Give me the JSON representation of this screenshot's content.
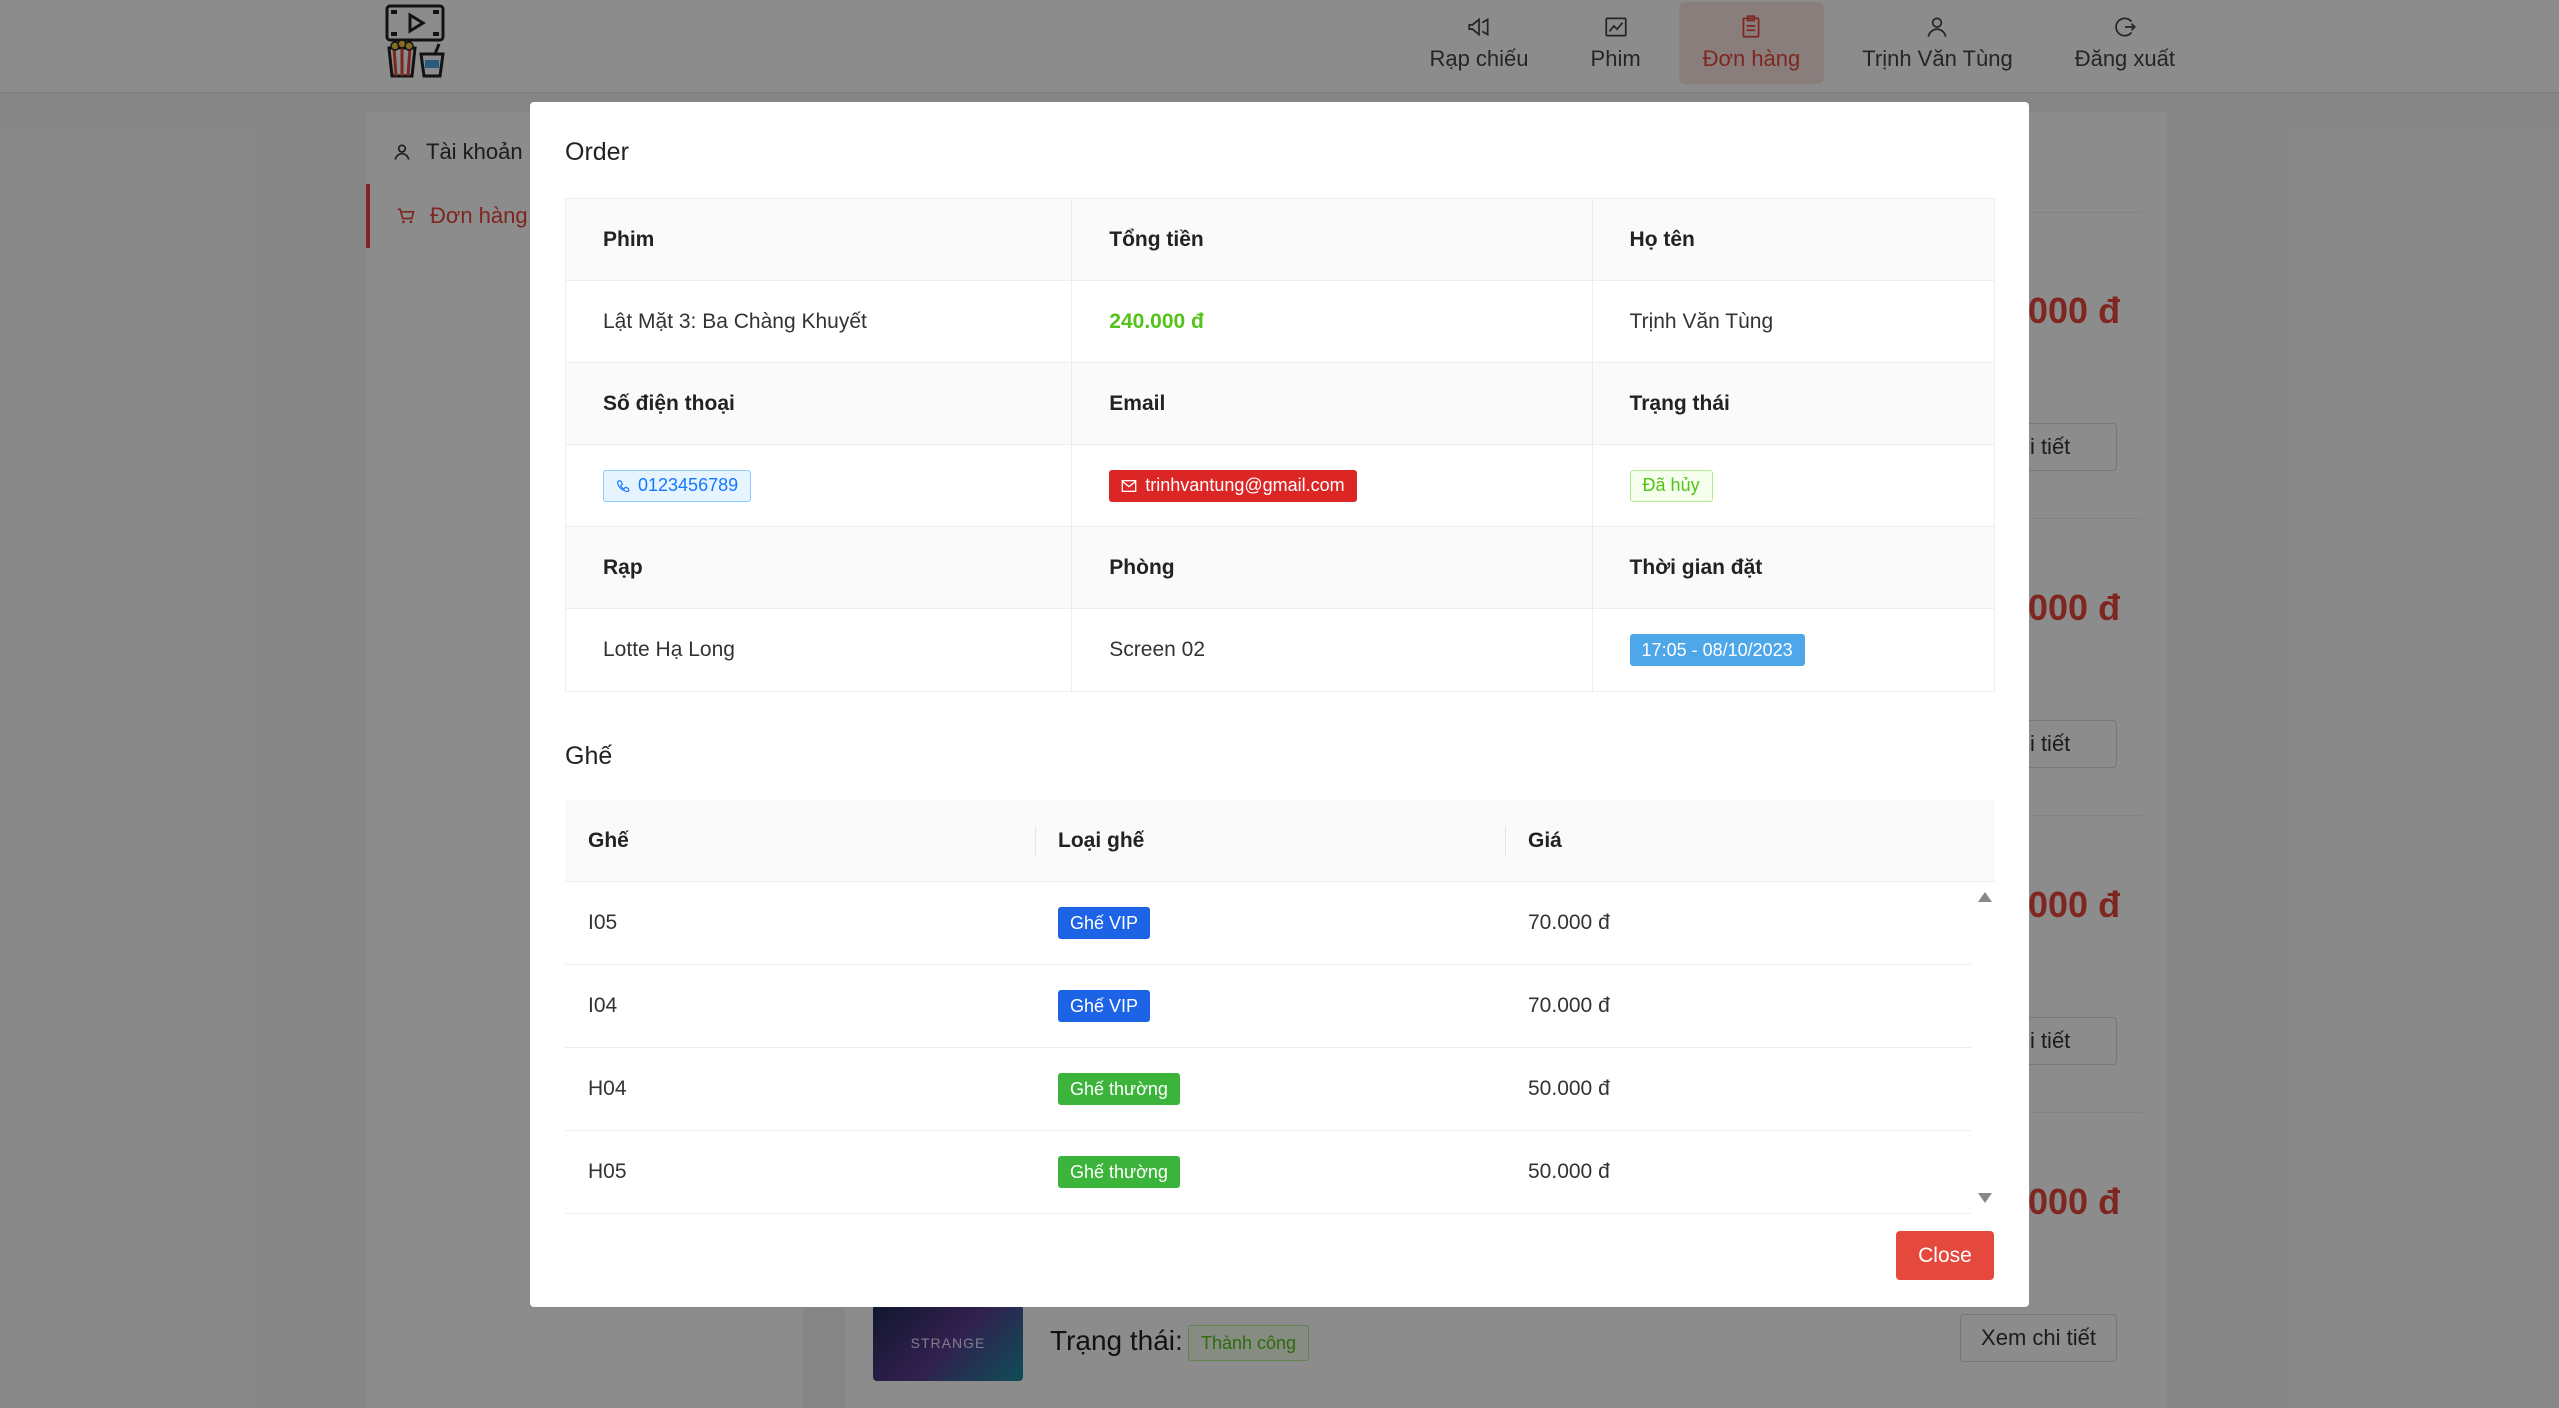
{
  "header": {
    "nav": [
      {
        "label": "Rạp chiếu",
        "icon": "megaphone-icon"
      },
      {
        "label": "Phim",
        "icon": "chart-icon"
      },
      {
        "label": "Đơn hàng",
        "icon": "clipboard-icon"
      },
      {
        "label": "Trịnh Văn Tùng",
        "icon": "user-icon"
      },
      {
        "label": "Đăng xuất",
        "icon": "logout-icon"
      }
    ],
    "active_index": 2
  },
  "sidebar": {
    "items": [
      {
        "label": "Tài khoản",
        "icon": "user-icon"
      },
      {
        "label": "Đơn hàng",
        "icon": "cart-icon"
      }
    ]
  },
  "background": {
    "prices": [
      "000 đ",
      "000 đ",
      "000 đ",
      "000 đ"
    ],
    "detail_buttons": [
      "chi tiết",
      "chi tiết",
      "chi tiết",
      "Xem chi tiết"
    ],
    "status_label": "Trạng thái:",
    "status_tag": "Thành công",
    "poster_text": "STRANGE"
  },
  "modal": {
    "title": "Order",
    "labels": {
      "film": "Phim",
      "total": "Tổng tiền",
      "name": "Họ tên",
      "phone": "Số điện thoại",
      "email": "Email",
      "status": "Trạng thái",
      "cinema": "Rạp",
      "room": "Phòng",
      "time": "Thời gian đặt"
    },
    "values": {
      "film": "Lật Mặt 3: Ba Chàng Khuyết",
      "total": "240.000 đ",
      "name": "Trịnh Văn Tùng",
      "phone": "0123456789",
      "email": "trinhvantung@gmail.com",
      "status": "Đã hủy",
      "cinema": "Lotte Hạ Long",
      "room": "Screen 02",
      "time": "17:05 - 08/10/2023"
    },
    "seats_title": "Ghế",
    "seat_columns": [
      "Ghế",
      "Loại ghế",
      "Giá"
    ],
    "seats": [
      {
        "seat": "I05",
        "type": "Ghế VIP",
        "price": "70.000 đ"
      },
      {
        "seat": "I04",
        "type": "Ghế VIP",
        "price": "70.000 đ"
      },
      {
        "seat": "H04",
        "type": "Ghế thường",
        "price": "50.000 đ"
      },
      {
        "seat": "H05",
        "type": "Ghế thường",
        "price": "50.000 đ"
      }
    ],
    "close_label": "Close"
  },
  "colors": {
    "accent": "#e5483c",
    "total_green": "#52c41a",
    "vip": "#1d63e6",
    "normal": "#3cb43c",
    "email_tag": "#dc2626",
    "time_tag": "#4ea7e8"
  }
}
